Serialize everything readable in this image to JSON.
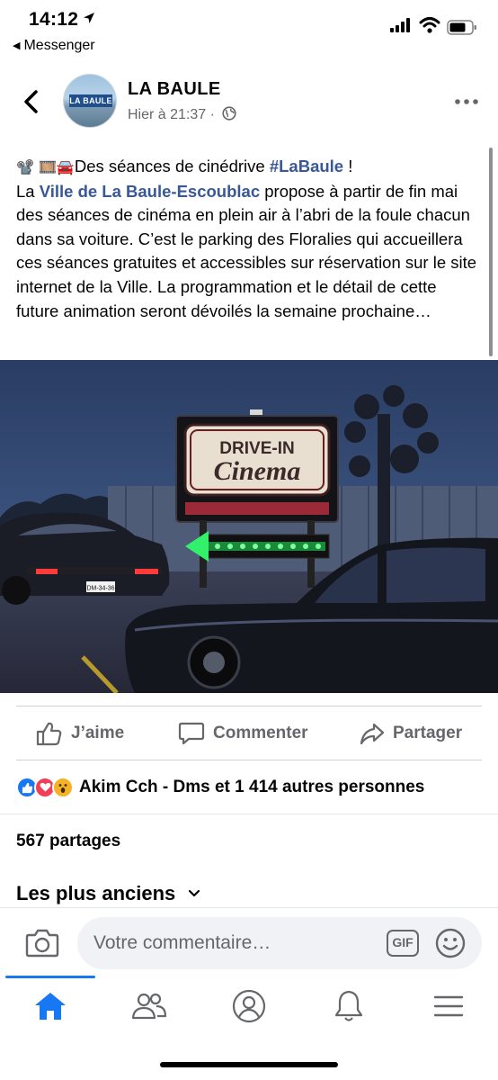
{
  "status_bar": {
    "time": "14:12",
    "back_app": "Messenger"
  },
  "post": {
    "page_name": "LA BAULE",
    "avatar_badge": "LA BAULE",
    "timestamp": "Hier à 21:37 ·",
    "text": {
      "emojis": "📽️ 🎞️🚘",
      "line1": "Des séances de cinédrive ",
      "hashtag": "#LaBaule",
      "line1_end": " !",
      "p_start": "La ",
      "mention": "Ville de La Baule-Escoublac",
      "body": " propose à partir de fin mai des séances de cinéma en plein air à l’abri de la foule chacun dans sa voiture. C’est le parking des Floralies qui accueillera ces séances gratuites et accessibles sur réservation sur le site internet de la Ville. La programmation et le détail de cette future animation seront dévoilés la semaine prochaine…"
    },
    "image": {
      "sign_line1": "DRIVE-IN",
      "sign_line2": "Cinema",
      "plate": "DM-34-36"
    }
  },
  "actions": {
    "like": "J’aime",
    "comment": "Commenter",
    "share": "Partager"
  },
  "reactions": {
    "summary": "Akim Cch - Dms et 1 414 autres personnes"
  },
  "shares": "567 partages",
  "comments_sort": "Les plus anciens",
  "comment_bar": {
    "placeholder": "Votre commentaire…",
    "gif": "GIF"
  },
  "colors": {
    "link": "#385898",
    "accent": "#1877f2",
    "secondary_text": "#65676b"
  }
}
